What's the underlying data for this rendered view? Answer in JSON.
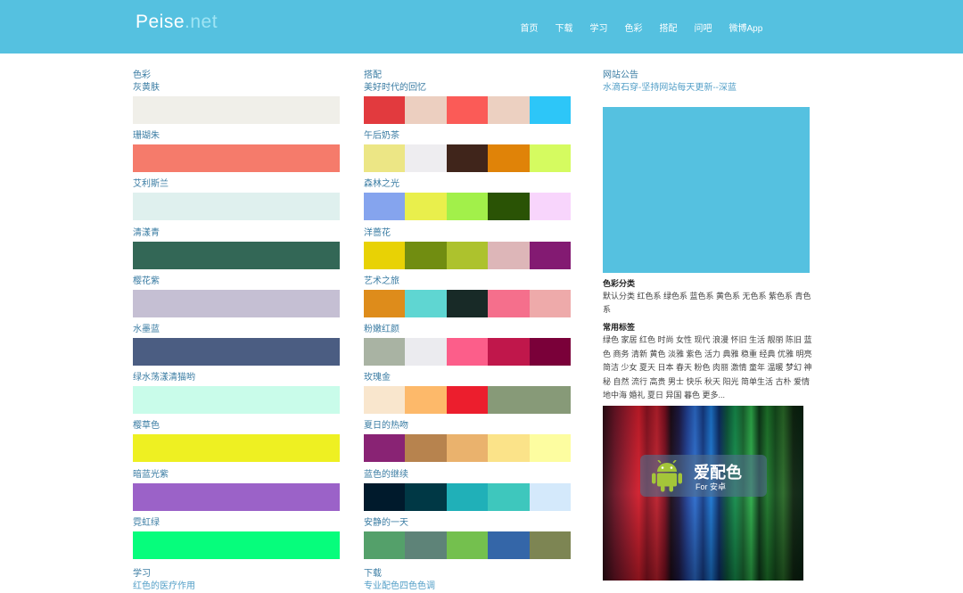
{
  "header": {
    "logo_main": "Peise",
    "logo_suffix": ".net",
    "nav": [
      "首页",
      "下载",
      "学习",
      "色彩",
      "搭配",
      "问吧",
      "微博App"
    ]
  },
  "colors_section": {
    "title": "色彩",
    "items": [
      {
        "label": "灰黄肤",
        "color": "#f0efe9"
      },
      {
        "label": "珊瑚朱",
        "color": "#f57b6b"
      },
      {
        "label": "艾利斯兰",
        "color": "#dff0ee"
      },
      {
        "label": "清漾青",
        "color": "#336756"
      },
      {
        "label": "樱花紫",
        "color": "#c5bfd3"
      },
      {
        "label": "水墨蓝",
        "color": "#4b5d82"
      },
      {
        "label": "绿水荡漾清猫哟",
        "color": "#c9fcea"
      },
      {
        "label": "樱草色",
        "color": "#eef022"
      },
      {
        "label": "暗蓝光紫",
        "color": "#9b62c8"
      },
      {
        "label": "霓虹绿",
        "color": "#06fd7c"
      }
    ]
  },
  "schemes_section": {
    "title": "搭配",
    "items": [
      {
        "label": "美好时代的回忆",
        "colors": [
          "#e23a3e",
          "#eccfc0",
          "#fb5b57",
          "#ecd0c1",
          "#2dc6f8"
        ]
      },
      {
        "label": "午后奶茶",
        "colors": [
          "#ece685",
          "#eeedf0",
          "#40251b",
          "#e08308",
          "#d5fb60"
        ]
      },
      {
        "label": "森林之光",
        "colors": [
          "#85a4ee",
          "#e9ef4c",
          "#a2f04a",
          "#2a5305",
          "#f8d5fc"
        ]
      },
      {
        "label": "洋蔷花",
        "colors": [
          "#e8d205",
          "#718d11",
          "#adc22d",
          "#ddb6b8",
          "#831a72"
        ]
      },
      {
        "label": "艺术之旅",
        "colors": [
          "#de8c1b",
          "#5fd6d2",
          "#182a27",
          "#f56f8c",
          "#eeaaaa"
        ]
      },
      {
        "label": "粉嫩红颜",
        "colors": [
          "#a9b3a3",
          "#ebebef",
          "#fc5e8a",
          "#c0174b",
          "#7a0039"
        ]
      },
      {
        "label": "玫瑰金",
        "colors": [
          "#f9e6cd",
          "#fdb96a",
          "#ec1e2d",
          "#879a78",
          "#879a78"
        ]
      },
      {
        "label": "夏日的热吻",
        "colors": [
          "#892374",
          "#b7834e",
          "#eab26d",
          "#fbe389",
          "#fdfda0"
        ]
      },
      {
        "label": "蓝色的继续",
        "colors": [
          "#001a2c",
          "#003845",
          "#20b0b8",
          "#3ec7bd",
          "#d4e9fb"
        ]
      },
      {
        "label": "安静的一天",
        "colors": [
          "#54a06a",
          "#5e8378",
          "#74c04e",
          "#3466a8",
          "#7d8553"
        ]
      }
    ]
  },
  "learn_section": {
    "title": "学习",
    "first_link": "红色的医疗作用"
  },
  "download_section": {
    "title": "下载",
    "first_link": "专业配色四色色调"
  },
  "sidebar": {
    "notice_title": "网站公告",
    "notice_text": "水滴石穿-坚持网站每天更新--深蓝",
    "ad_color": "#55c1e0",
    "category_title": "色彩分类",
    "category_text": "默认分类 红色系 绿色系 蓝色系 黄色系 无色系 紫色系 青色系",
    "tags_title": "常用标签",
    "tags_text": "绿色 家居 红色 时尚 女性 现代 浪漫 怀旧 生活 靓丽 陈旧 蓝色 商务 清新 黄色 淡雅 紫色 活力 典雅 稳重 经典 优雅 明亮 简洁 少女 夏天 日本 春天 粉色 肉丽 激情 童年 温暖 梦幻 神秘 自然 流行 高贵 男士 快乐 秋天 阳光 简单生活 古朴 爱情 地中海 婚礼 夏日 异国 暮色 更多..."
  },
  "app_banner": {
    "name": "爱配色",
    "subtitle": "For 安卓",
    "icon": "android-icon"
  }
}
